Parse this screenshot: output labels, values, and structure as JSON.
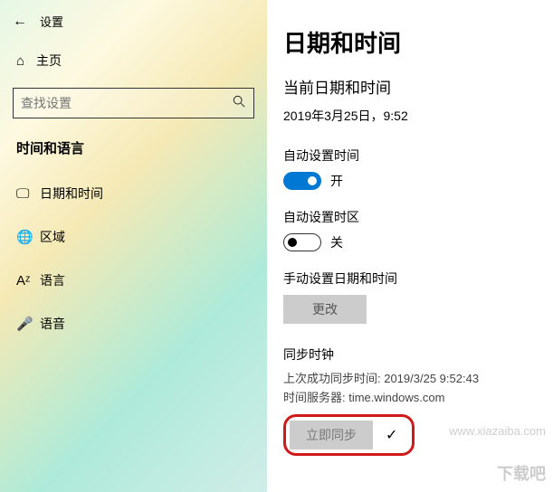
{
  "header": {
    "title": "设置"
  },
  "home": {
    "label": "主页"
  },
  "search": {
    "placeholder": "查找设置"
  },
  "sidebar": {
    "section_title": "时间和语言",
    "items": [
      {
        "label": "日期和时间"
      },
      {
        "label": "区域"
      },
      {
        "label": "语言"
      },
      {
        "label": "语音"
      }
    ]
  },
  "main": {
    "title": "日期和时间",
    "current_label": "当前日期和时间",
    "current_value": "2019年3月25日，9:52",
    "auto_time": {
      "label": "自动设置时间",
      "state": "开"
    },
    "auto_tz": {
      "label": "自动设置时区",
      "state": "关"
    },
    "manual": {
      "label": "手动设置日期和时间",
      "button": "更改"
    },
    "sync": {
      "title": "同步时钟",
      "last": "上次成功同步时间: 2019/3/25 9:52:43",
      "server": "时间服务器: time.windows.com",
      "button": "立即同步"
    }
  },
  "watermark": {
    "url": "www.xiazaiba.com",
    "brand": "下载吧"
  }
}
